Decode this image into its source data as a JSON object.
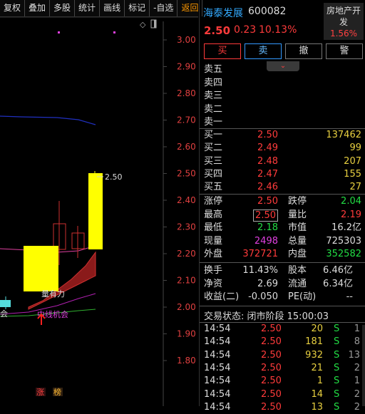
{
  "toolbar": {
    "items": [
      "复权",
      "叠加",
      "多股",
      "统计",
      "画线",
      "标记",
      "-自选",
      "返回"
    ]
  },
  "chart": {
    "price_axis": [
      "3.00",
      "2.90",
      "2.80",
      "2.70",
      "2.60",
      "2.50",
      "2.40",
      "2.30",
      "2.20",
      "2.10",
      "2.00",
      "1.90",
      "1.80"
    ],
    "high_marker": "2.50",
    "annotation_momentum": "量有力",
    "annotation_midline": "中线机会",
    "annotation_left": "会",
    "badge_zhang": "涨",
    "badge_bang": "榜"
  },
  "stock": {
    "name": "海泰发展",
    "code": "600082",
    "price": "2.50",
    "change": "0.23",
    "change_pct": "10.13%",
    "sector": "房地产开发",
    "sector_pct": "1.56%"
  },
  "actions": {
    "buy": "买",
    "sell": "卖",
    "cancel": "撤",
    "alert": "警"
  },
  "asks": [
    {
      "label": "卖五",
      "price": "",
      "vol": ""
    },
    {
      "label": "卖四",
      "price": "",
      "vol": ""
    },
    {
      "label": "卖三",
      "price": "",
      "vol": ""
    },
    {
      "label": "卖二",
      "price": "",
      "vol": ""
    },
    {
      "label": "卖一",
      "price": "",
      "vol": ""
    }
  ],
  "bids": [
    {
      "label": "买一",
      "price": "2.50",
      "vol": "137462"
    },
    {
      "label": "买二",
      "price": "2.49",
      "vol": "99"
    },
    {
      "label": "买三",
      "price": "2.48",
      "vol": "207"
    },
    {
      "label": "买四",
      "price": "2.47",
      "vol": "155"
    },
    {
      "label": "买五",
      "price": "2.46",
      "vol": "27"
    }
  ],
  "stats": {
    "limit_up_label": "涨停",
    "limit_up": "2.50",
    "limit_down_label": "跌停",
    "limit_down": "2.04",
    "high_label": "最高",
    "high": "2.50",
    "vol_ratio_label": "量比",
    "vol_ratio": "2.19",
    "low_label": "最低",
    "low": "2.18",
    "mktcap_label": "市值",
    "mktcap": "16.2亿",
    "cur_vol_label": "现量",
    "cur_vol": "2498",
    "total_vol_label": "总量",
    "total_vol": "725303",
    "outer_label": "外盘",
    "outer": "372721",
    "inner_label": "内盘",
    "inner": "352582",
    "turnover_label": "换手",
    "turnover": "11.43%",
    "shares_label": "股本",
    "shares": "6.46亿",
    "nav_label": "净资",
    "nav": "2.69",
    "float_label": "流通",
    "float": "6.34亿",
    "eps_label": "收益(二)",
    "eps": "-0.050",
    "pe_label": "PE(动)",
    "pe": "--"
  },
  "trade_status": "交易状态: 闭市阶段 15:00:03",
  "ticks": [
    {
      "time": "14:54",
      "price": "2.50",
      "vol": "20",
      "side": "S",
      "count": "1"
    },
    {
      "time": "14:54",
      "price": "2.50",
      "vol": "181",
      "side": "S",
      "count": "8"
    },
    {
      "time": "14:54",
      "price": "2.50",
      "vol": "932",
      "side": "S",
      "count": "13"
    },
    {
      "time": "14:54",
      "price": "2.50",
      "vol": "21",
      "side": "S",
      "count": "2"
    },
    {
      "time": "14:54",
      "price": "2.50",
      "vol": "1",
      "side": "S",
      "count": "1"
    },
    {
      "time": "14:54",
      "price": "2.50",
      "vol": "14",
      "side": "S",
      "count": "2"
    },
    {
      "time": "14:54",
      "price": "2.50",
      "vol": "13",
      "side": "S",
      "count": "2"
    }
  ],
  "colors": {
    "up": "#ff3b3b",
    "down": "#22dd44",
    "vol": "#e8d040",
    "candle_up": "#ffff00",
    "ma_blue": "#2030c0"
  }
}
